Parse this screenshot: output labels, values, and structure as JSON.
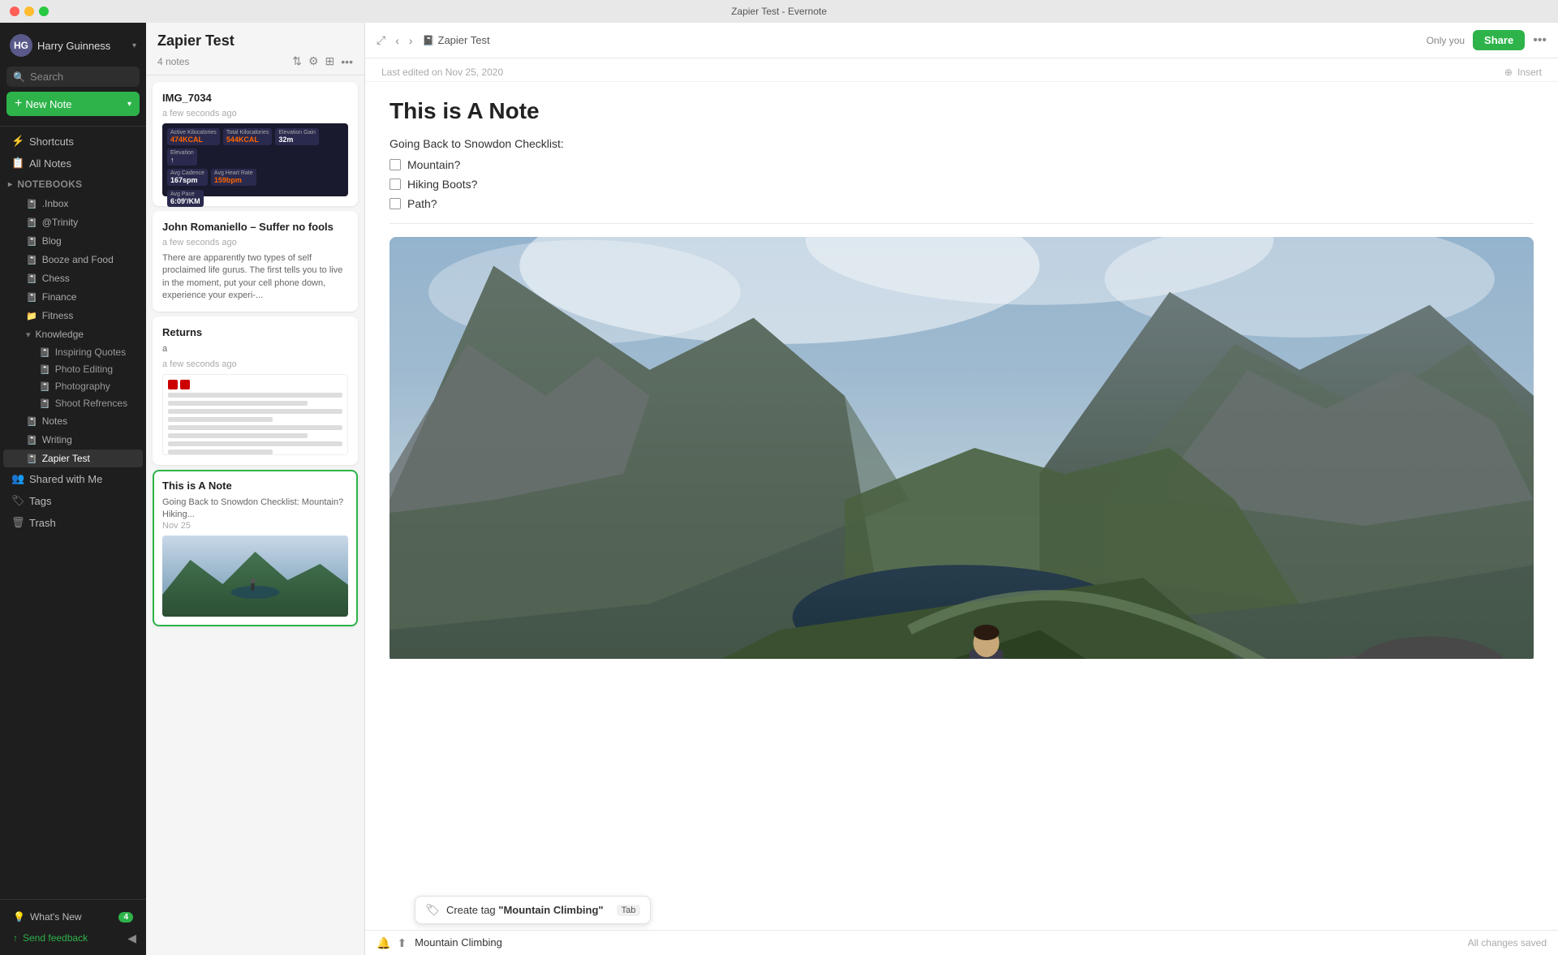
{
  "window": {
    "title": "Zapier Test - Evernote"
  },
  "sidebar": {
    "user": {
      "name": "Harry Guinness",
      "initials": "HG"
    },
    "search_placeholder": "Search",
    "new_note_label": "New Note",
    "nav_items": [
      {
        "id": "shortcuts",
        "label": "Shortcuts",
        "icon": "⚡"
      },
      {
        "id": "all_notes",
        "label": "All Notes",
        "icon": "📋"
      }
    ],
    "notebooks_header": "Notebooks",
    "notebooks": [
      {
        "id": "inbox",
        "label": ".Inbox"
      },
      {
        "id": "trinity",
        "label": "@Trinity"
      },
      {
        "id": "blog",
        "label": "Blog"
      },
      {
        "id": "booze_food",
        "label": "Booze and Food"
      },
      {
        "id": "chess",
        "label": "Chess"
      },
      {
        "id": "finance",
        "label": "Finance"
      },
      {
        "id": "fitness",
        "label": "Fitness"
      },
      {
        "id": "knowledge",
        "label": "Knowledge",
        "expanded": true
      },
      {
        "id": "notes",
        "label": "Notes"
      },
      {
        "id": "writing",
        "label": "Writing"
      },
      {
        "id": "zapier_test",
        "label": "Zapier Test",
        "active": true
      }
    ],
    "knowledge_children": [
      {
        "id": "inspiring_quotes",
        "label": "Inspiring Quotes"
      },
      {
        "id": "photo_editing",
        "label": "Photo Editing"
      },
      {
        "id": "photography",
        "label": "Photography"
      },
      {
        "id": "shoot_references",
        "label": "Shoot Refrences"
      }
    ],
    "shared_with_me": "Shared with Me",
    "tags_label": "Tags",
    "trash_label": "Trash",
    "whats_new_label": "What's New",
    "whats_new_badge": "4",
    "feedback_label": "Send feedback"
  },
  "notes_list": {
    "notebook_title": "Zapier Test",
    "notes_count": "4 notes",
    "notes": [
      {
        "id": "img_7034",
        "title": "IMG_7034",
        "time": "a few seconds ago",
        "preview": "",
        "has_fitness_image": true
      },
      {
        "id": "john_romano",
        "title": "John Romaniello – Suffer no fools",
        "time": "a few seconds ago",
        "preview": "There are apparently two types of self proclaimed life gurus. The first tells you to live in the moment, put your cell phone down, experience your experi-..."
      },
      {
        "id": "returns",
        "title": "Returns",
        "time": "a few seconds ago",
        "preview": "a",
        "has_doc_image": true
      },
      {
        "id": "this_is_a_note",
        "title": "This is A Note",
        "date": "Nov 25",
        "preview": "Going Back to Snowdon Checklist: Mountain? Hiking...",
        "has_mountain_thumbnail": true,
        "selected": true
      }
    ]
  },
  "note": {
    "breadcrumb": "Zapier Test",
    "last_edited": "Last edited on Nov 25, 2020",
    "title": "This is A Note",
    "checklist_label": "Going Back to Snowdon Checklist:",
    "checklist_items": [
      "Mountain?",
      "Hiking Boots?",
      "Path?"
    ],
    "only_you": "Only you",
    "share_label": "Share",
    "insert_label": "Insert"
  },
  "bottom_bar": {
    "tag_placeholder": "Mountain Climbing",
    "tag_suggestion": "Create tag \"Mountain Climbing\"",
    "tab_label": "Tab",
    "saved_text": "All changes saved"
  }
}
